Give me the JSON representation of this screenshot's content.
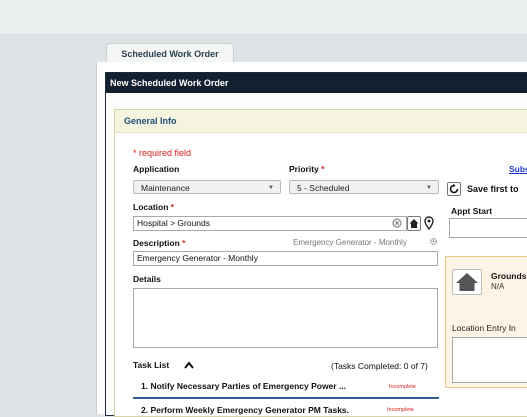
{
  "tab": {
    "label": "Scheduled Work Order"
  },
  "dialog": {
    "title": "New Scheduled Work Order"
  },
  "section": {
    "title": "General Info"
  },
  "form": {
    "required_note": "* required field",
    "application": {
      "label": "Application",
      "value": "Maintenance"
    },
    "priority": {
      "label": "Priority",
      "required_mark": "*",
      "value": "5 - Scheduled"
    },
    "location": {
      "label": "Location",
      "required_mark": "*",
      "value": "Hospital > Grounds"
    },
    "description": {
      "label": "Description",
      "required_mark": "*",
      "value": "Emergency Generator - Monthly",
      "template_hint": "Emergency Generator - Monthly"
    },
    "details": {
      "label": "Details",
      "value": ""
    }
  },
  "task_list": {
    "label": "Task List",
    "completed": "(Tasks Completed: 0 of 7)",
    "items": [
      {
        "text": "1. Notify Necessary Parties of Emergency Power ...",
        "status": "Incomplete"
      },
      {
        "text": "2. Perform Weekly Emergency Generator PM Tasks.",
        "status": "Incomplete"
      }
    ]
  },
  "right": {
    "subscribe_link": "Subsc",
    "save_first": "Save first to",
    "appt_start_label": "Appt Start",
    "location_card": {
      "name": "Grounds",
      "sub": "N/A",
      "entry_label": "Location Entry In"
    }
  },
  "icons": {
    "clear": "clear-circle-icon",
    "home": "home-icon",
    "pin": "map-pin-icon",
    "refresh": "refresh-icon",
    "collapse": "chevron-up-icon"
  }
}
